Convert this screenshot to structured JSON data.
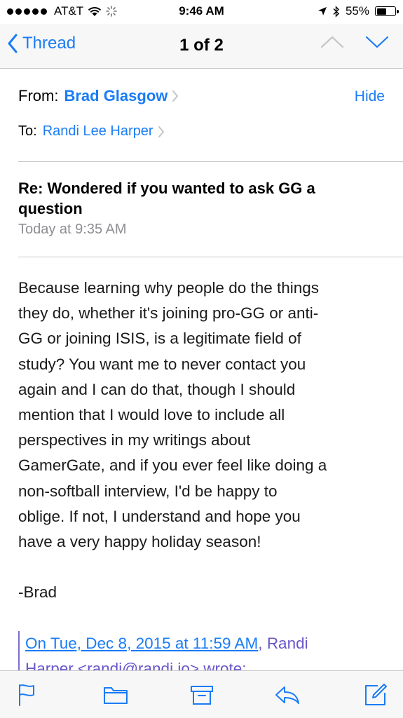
{
  "status_bar": {
    "carrier": "AT&T",
    "time": "9:46 AM",
    "battery_percent": "55%",
    "battery_level": 0.55
  },
  "nav": {
    "back_label": "Thread",
    "title": "1 of 2"
  },
  "header": {
    "from_label": "From:",
    "from_name": "Brad Glasgow",
    "hide_label": "Hide",
    "to_label": "To:",
    "to_name": "Randi Lee Harper",
    "subject_line1": "Re: Wondered if you wanted to ask GG a",
    "subject_line2": "question",
    "date": "Today at 9:35 AM"
  },
  "message": {
    "lines": [
      "Because learning why people do the things",
      "they do, whether it's joining pro-GG or anti-",
      "GG or joining ISIS, is a legitimate field of",
      "study? You want me to never contact you",
      "again and I can do that, though I should",
      "mention that I would love to include all",
      "perspectives in my writings about",
      "GamerGate, and if you ever feel like doing a",
      "non-softball interview, I'd be happy to",
      "oblige. If not, I understand and hope you",
      "have a very happy holiday season!"
    ],
    "signature": "-Brad"
  },
  "quote": {
    "link_text": "On Tue, Dec 8, 2015 at 11:59 AM",
    "separator": ", ",
    "name_text": "Randi",
    "line2": "Harper <randi@randi.io> wrote:"
  },
  "icons": {
    "accent_color": "#1a7cf5",
    "toolbar": [
      "flag-icon",
      "folder-icon",
      "archive-icon",
      "reply-icon",
      "compose-icon"
    ]
  }
}
